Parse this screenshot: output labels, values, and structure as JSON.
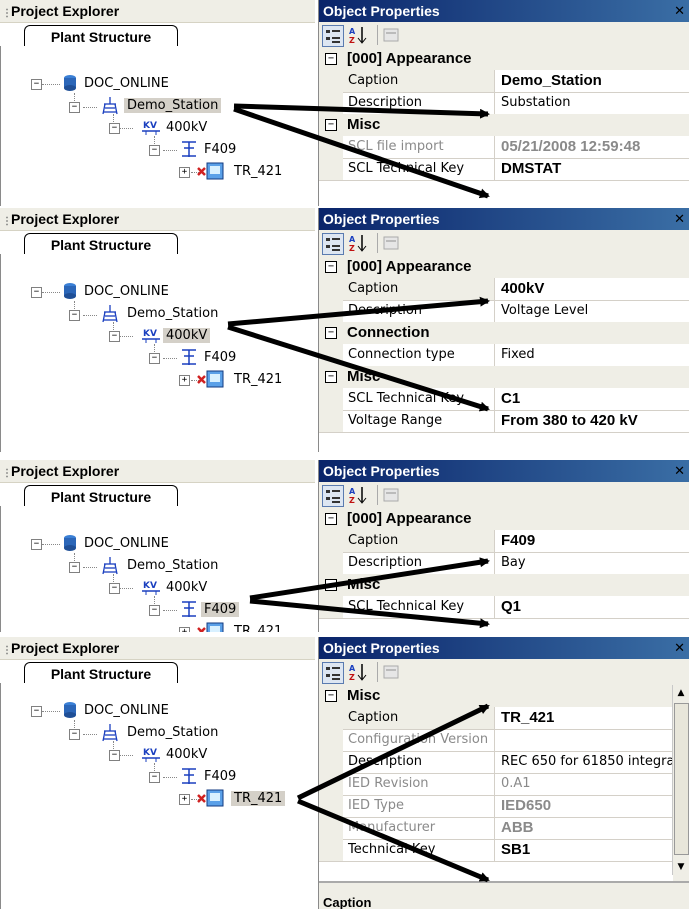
{
  "panels": [
    {
      "explorer_title": "Project Explorer",
      "tab": "Plant Structure",
      "tree": [
        "DOC_ONLINE",
        "Demo_Station",
        "400kV",
        "F409",
        "TR_421"
      ],
      "selected": "Demo_Station",
      "props_title": "Object Properties",
      "props": [
        {
          "type": "cat",
          "label": "[000] Appearance"
        },
        {
          "type": "row",
          "key": "Caption",
          "value": "Demo_Station",
          "bold": true
        },
        {
          "type": "row",
          "key": "Description",
          "value": "Substation"
        },
        {
          "type": "cat",
          "label": "Misc"
        },
        {
          "type": "row",
          "key": "SCL file import",
          "value": "05/21/2008 12:59:48",
          "bold": true,
          "dim": true
        },
        {
          "type": "row",
          "key": "SCL Technical Key",
          "value": "DMSTAT",
          "bold": true
        }
      ]
    },
    {
      "explorer_title": "Project Explorer",
      "tab": "Plant Structure",
      "tree": [
        "DOC_ONLINE",
        "Demo_Station",
        "400kV",
        "F409",
        "TR_421"
      ],
      "selected": "400kV",
      "props_title": "Object Properties",
      "props": [
        {
          "type": "cat",
          "label": "[000] Appearance"
        },
        {
          "type": "row",
          "key": "Caption",
          "value": "400kV",
          "bold": true
        },
        {
          "type": "row",
          "key": "Description",
          "value": "Voltage Level"
        },
        {
          "type": "cat",
          "label": "Connection"
        },
        {
          "type": "row",
          "key": "Connection type",
          "value": "Fixed"
        },
        {
          "type": "cat",
          "label": "Misc"
        },
        {
          "type": "row",
          "key": "SCL Technical Key",
          "value": "C1",
          "bold": true
        },
        {
          "type": "row",
          "key": "Voltage Range",
          "value": "From 380 to 420 kV",
          "bold": true
        }
      ]
    },
    {
      "explorer_title": "Project Explorer",
      "tab": "Plant Structure",
      "tree": [
        "DOC_ONLINE",
        "Demo_Station",
        "400kV",
        "F409",
        "TR_421"
      ],
      "selected": "F409",
      "props_title": "Object Properties",
      "props": [
        {
          "type": "cat",
          "label": "[000] Appearance"
        },
        {
          "type": "row",
          "key": "Caption",
          "value": "F409",
          "bold": true
        },
        {
          "type": "row",
          "key": "Description",
          "value": "Bay"
        },
        {
          "type": "cat",
          "label": "Misc"
        },
        {
          "type": "row",
          "key": "SCL Technical Key",
          "value": "Q1",
          "bold": true
        }
      ]
    },
    {
      "explorer_title": "Project Explorer",
      "tab": "Plant Structure",
      "tree": [
        "DOC_ONLINE",
        "Demo_Station",
        "400kV",
        "F409",
        "TR_421"
      ],
      "selected": "TR_421",
      "props_title": "Object Properties",
      "props": [
        {
          "type": "cat",
          "label": "Misc"
        },
        {
          "type": "row",
          "key": "Caption",
          "value": "TR_421",
          "bold": true
        },
        {
          "type": "row",
          "key": "Configuration Version",
          "value": "",
          "dim": true
        },
        {
          "type": "row",
          "key": "Description",
          "value": "REC 650 for 61850 integra"
        },
        {
          "type": "row",
          "key": "IED Revision",
          "value": "0.A1",
          "dim": true
        },
        {
          "type": "row",
          "key": "IED Type",
          "value": "IED650",
          "bold": true,
          "dim": true
        },
        {
          "type": "row",
          "key": "Manufacturer",
          "value": "ABB",
          "bold": true,
          "dim": true
        },
        {
          "type": "row",
          "key": "Technical Key",
          "value": "SB1",
          "bold": true
        }
      ],
      "footer": "Caption"
    }
  ],
  "colors": {
    "accent": "#0a246a",
    "panel_bg": "#efeee6",
    "selection": "#d4d0c8"
  },
  "icons": [
    "database-icon",
    "substation-icon",
    "voltage-level-icon",
    "bay-icon",
    "ied-icon",
    "close-icon",
    "categorized-icon",
    "alphabetical-icon",
    "property-pages-icon"
  ]
}
